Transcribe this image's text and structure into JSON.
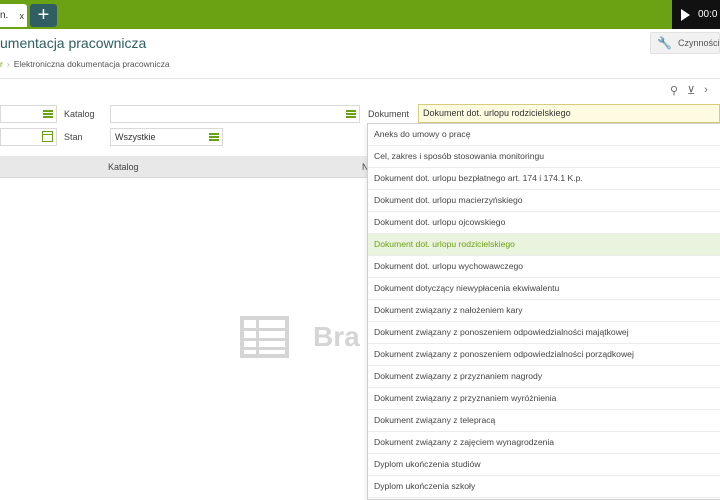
{
  "tab": {
    "label": "n.",
    "close": "x"
  },
  "add_tab": "+",
  "player": {
    "time": "00:0"
  },
  "page": {
    "title": "umentacja pracownicza"
  },
  "actions": {
    "label": "Czynności"
  },
  "breadcrumb": {
    "prev": "r",
    "current": "Elektroniczna dokumentacja pracownicza"
  },
  "filters": {
    "katalog_label": "Katalog",
    "katalog_value": "",
    "stan_label": "Stan",
    "stan_value": "Wszystkie",
    "dokument_label": "Dokument",
    "dokument_value": "Dokument dot. urlopu rodzicielskiego"
  },
  "grid": {
    "col_katalog": "Katalog",
    "col_n": "N"
  },
  "nodata": {
    "text": "Bra"
  },
  "dropdown": {
    "items": [
      "Aneks do umowy o pracę",
      "Cel, zakres i sposób stosowania monitoringu",
      "Dokument dot. urlopu bezpłatnego art. 174 i 174.1 K.p.",
      "Dokument dot. urlopu macierzyńskiego",
      "Dokument dot. urlopu ojcowskiego",
      "Dokument dot. urlopu rodzicielskiego",
      "Dokument dot. urlopu wychowawczego",
      "Dokument dotyczący niewypłacenia ekwiwalentu",
      "Dokument związany z nałożeniem kary",
      "Dokument związany z ponoszeniem odpowiedzialności majątkowej",
      "Dokument związany z ponoszeniem odpowiedzialności porządkowej",
      "Dokument związany z przyznaniem nagrody",
      "Dokument związany z przyznaniem wyróżnienia",
      "Dokument związany z telepracą",
      "Dokument związany z zajęciem wynagrodzenia",
      "Dyplom ukończenia studiów",
      "Dyplom ukończenia szkoły"
    ],
    "selected_index": 5
  },
  "colors": {
    "brand": "#6aa213",
    "accent_dark": "#2f5e63"
  }
}
